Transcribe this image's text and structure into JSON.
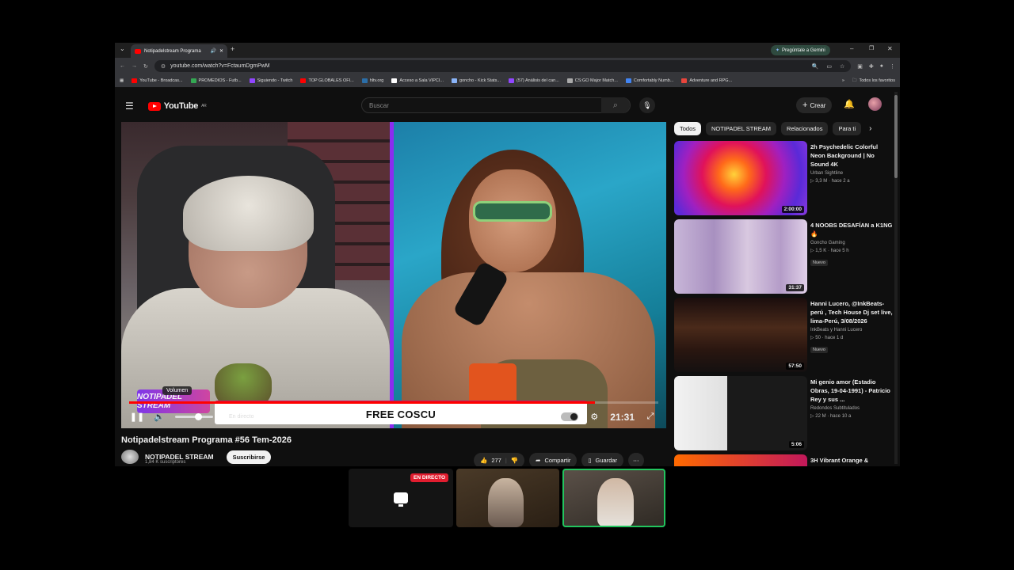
{
  "browser": {
    "tab_title": "Notipadelstream Programa",
    "gemini_label": "Pregúntale a Gemini",
    "url": "youtube.com/watch?v=FctaumDgmPwM",
    "bookmarks": [
      {
        "label": "YouTube - Broadcas...",
        "color": "#ff0000"
      },
      {
        "label": "PROMEDIOS - Futb...",
        "color": "#34a853"
      },
      {
        "label": "Siguiendo - Twitch",
        "color": "#9146ff"
      },
      {
        "label": "TOP GLOBALES OFI...",
        "color": "#ff0000"
      },
      {
        "label": "hltv.org",
        "color": "#2b6ea8"
      },
      {
        "label": "Acceso a Sala VIPCI...",
        "color": "#ffffff"
      },
      {
        "label": "goncho - Kick Stats...",
        "color": "#8ab4f8"
      },
      {
        "label": "(57) Análisis del can...",
        "color": "#9146ff"
      },
      {
        "label": "CS:GO Major Match...",
        "color": "#aaaaaa"
      },
      {
        "label": "Comfortably Numb...",
        "color": "#4285f4"
      },
      {
        "label": "Adventure and RPG...",
        "color": "#e8453c"
      }
    ],
    "all_favorites": "Todos los favoritos"
  },
  "youtube": {
    "logo_text": "YouTube",
    "logo_region": "AR",
    "search_placeholder": "Buscar",
    "create_label": "Crear"
  },
  "player": {
    "banner_text": "FREE COSCU",
    "stream_logo_text": "NOTIPADEL STREAM",
    "volume_tooltip": "Volumen",
    "live_chip": "En directo",
    "overlay_time": "21:31",
    "progress": 0.88,
    "volume_level": 0.6
  },
  "video": {
    "title": "Notipadelstream Programa #56 Tem-2026",
    "channel": "NOTIPADEL STREAM",
    "subscribers": "1,84 K suscriptores",
    "subscribe_label": "Suscribirse",
    "likes": "277",
    "share_label": "Compartir",
    "save_label": "Guardar"
  },
  "chips": [
    "Todos",
    "NOTIPADEL STREAM",
    "Relacionados",
    "Para ti"
  ],
  "recommendations": [
    {
      "title": "2h Psychedelic Colorful Neon Background | No Sound 4K",
      "channel": "Urban Sightline",
      "stats": "▷ 3,3 M · hace 2 a",
      "duration": "2:00:00",
      "badge": ""
    },
    {
      "title": "4 NOOBS DESAFÍAN a K1NG 🔥",
      "channel": "Goncho Gaming",
      "stats": "▷ 1,5 K · hace 5 h",
      "duration": "31:37",
      "badge": "Nuevo"
    },
    {
      "title": "Hanni Lucero, @InkBeats-perú , Tech House Dj set live, lima-Perú, 3/08/2026",
      "channel": "InkBeats y Hanni Lucero",
      "stats": "▷ 50 · hace 1 d",
      "duration": "57:50",
      "badge": "Nuevo"
    },
    {
      "title": "Mi genio amor (Estadio Obras, 19-04-1991) - Patricio Rey y sus ...",
      "channel": "Redondos Subtitulados",
      "stats": "▷ 22 M · hace 10 a",
      "duration": "5:06",
      "badge": ""
    },
    {
      "title": "3H Vibrant Orange &",
      "channel": "",
      "stats": "",
      "duration": "",
      "badge": ""
    }
  ],
  "bottom": {
    "live_badge": "EN DIRECTO"
  }
}
